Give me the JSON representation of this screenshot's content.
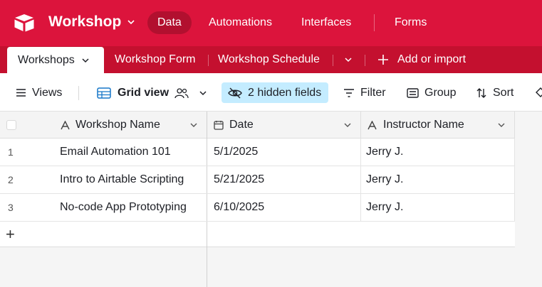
{
  "app": {
    "name": "Workshop",
    "nav": [
      "Data",
      "Automations",
      "Interfaces",
      "Forms"
    ]
  },
  "tabs": {
    "active": "Workshops",
    "items": [
      "Workshop Form",
      "Workshop Schedule"
    ],
    "add_label": "Add or import"
  },
  "toolbar": {
    "views": "Views",
    "grid_view": "Grid view",
    "hidden_fields": "2 hidden fields",
    "filter": "Filter",
    "group": "Group",
    "sort": "Sort"
  },
  "table": {
    "columns": [
      "Workshop Name",
      "Date",
      "Instructor Name"
    ],
    "rows": [
      {
        "num": "1",
        "name": "Email Automation 101",
        "date": "5/1/2025",
        "instructor": "Jerry J."
      },
      {
        "num": "2",
        "name": "Intro to Airtable Scripting",
        "date": "5/21/2025",
        "instructor": "Jerry J."
      },
      {
        "num": "3",
        "name": "No-code App Prototyping",
        "date": "6/10/2025",
        "instructor": "Jerry J."
      }
    ],
    "add_row_symbol": "+"
  },
  "colors": {
    "brand": "#dc143c",
    "tab_bar": "#c4102f",
    "hidden_fields_bg": "#c4ecff"
  }
}
